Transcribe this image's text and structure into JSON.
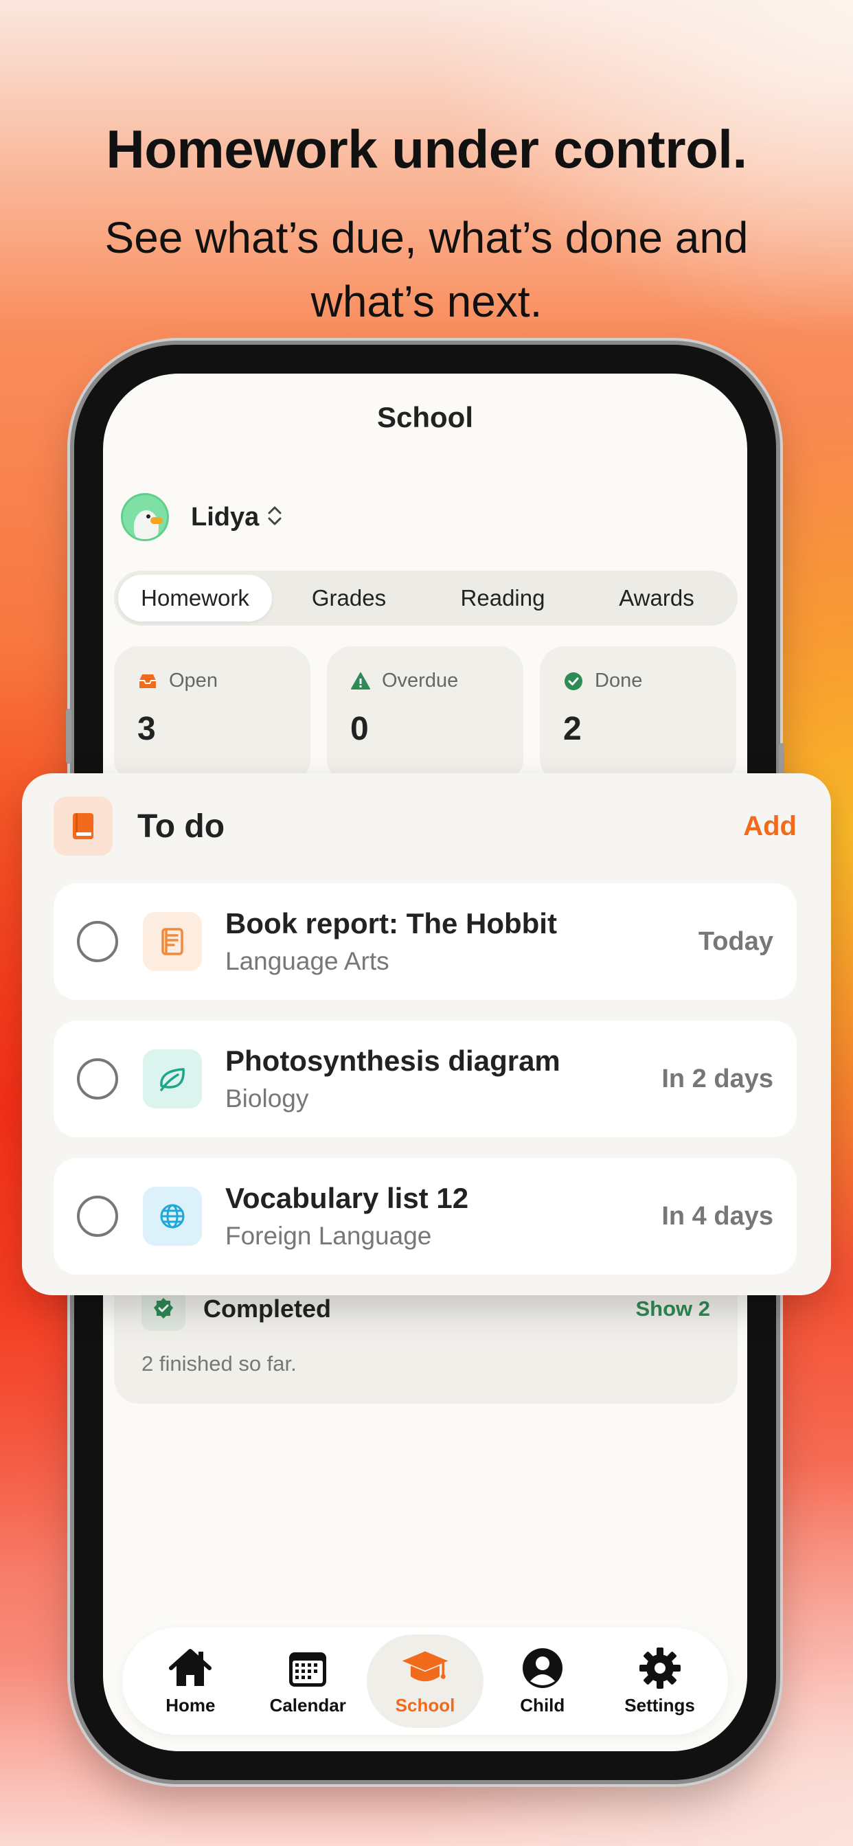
{
  "marketing": {
    "headline": "Homework under control.",
    "subline": "See what’s due, what’s done and what’s next."
  },
  "screen": {
    "title": "School",
    "profile": {
      "name": "Lidya",
      "avatar_icon": "duck-avatar",
      "switch_icon": "chevron-up-down-icon"
    },
    "segments": [
      {
        "label": "Homework",
        "active": true
      },
      {
        "label": "Grades",
        "active": false
      },
      {
        "label": "Reading",
        "active": false
      },
      {
        "label": "Awards",
        "active": false
      }
    ],
    "stats": [
      {
        "label": "Open",
        "value": "3",
        "icon": "inbox-icon",
        "color": "#f26a1b"
      },
      {
        "label": "Overdue",
        "value": "0",
        "icon": "warning-icon",
        "color": "#2f8a55"
      },
      {
        "label": "Done",
        "value": "2",
        "icon": "check-circle-icon",
        "color": "#2f8a55"
      }
    ],
    "completed": {
      "title": "Completed",
      "action": "Show 2",
      "subtitle": "2 finished so far."
    },
    "tabbar": [
      {
        "label": "Home",
        "icon": "home-icon",
        "active": false
      },
      {
        "label": "Calendar",
        "icon": "calendar-icon",
        "active": false
      },
      {
        "label": "School",
        "icon": "graduation-cap-icon",
        "active": true
      },
      {
        "label": "Child",
        "icon": "person-icon",
        "active": false
      },
      {
        "label": "Settings",
        "icon": "gear-icon",
        "active": false
      }
    ]
  },
  "todo": {
    "title": "To do",
    "add_label": "Add",
    "icon": "book-icon",
    "tasks": [
      {
        "title": "Book report: The Hobbit",
        "subject": "Language Arts",
        "due": "Today",
        "icon": "book-report-icon",
        "icon_bg": "#fdece0",
        "icon_color": "#f28a3c"
      },
      {
        "title": "Photosynthesis diagram",
        "subject": "Biology",
        "due": "In 2 days",
        "icon": "leaf-icon",
        "icon_bg": "#dcf4ee",
        "icon_color": "#1ea58a"
      },
      {
        "title": "Vocabulary list 12",
        "subject": "Foreign Language",
        "due": "In 4 days",
        "icon": "globe-icon",
        "icon_bg": "#dcf1fa",
        "icon_color": "#1ea7d8"
      }
    ]
  },
  "colors": {
    "accent": "#f26a1b",
    "success": "#2f8a55"
  }
}
